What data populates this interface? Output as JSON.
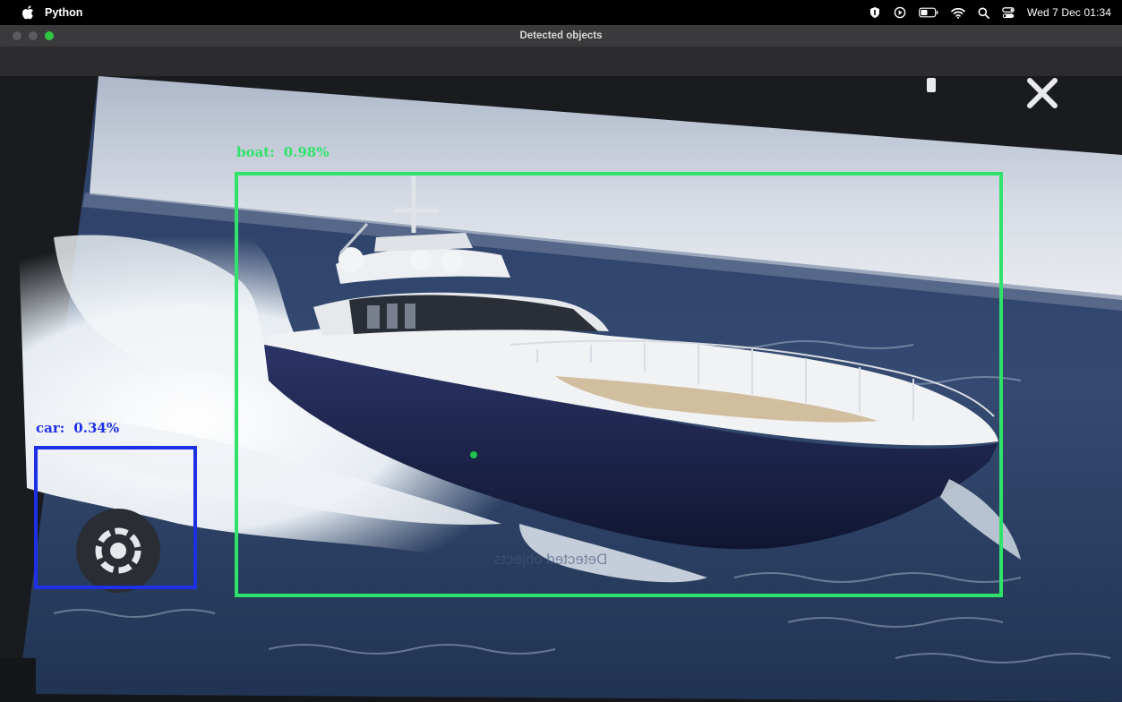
{
  "menubar": {
    "app_name": "Python",
    "clock": "Wed 7 Dec  01:34",
    "icons": [
      "apple-icon",
      "shield-icon",
      "play-icon",
      "battery-icon",
      "wifi-icon",
      "search-icon",
      "control-center-icon"
    ]
  },
  "window": {
    "title": "Detected objects",
    "buttons": [
      "close",
      "minimize",
      "zoom"
    ]
  },
  "detections": [
    {
      "label": "boat:",
      "score": "0.98%",
      "color": "#2fe36a"
    },
    {
      "label": "car:",
      "score": "0.34%",
      "color": "#1e2fe8"
    }
  ],
  "overlay": {
    "reflection_text": "Detected objects"
  }
}
